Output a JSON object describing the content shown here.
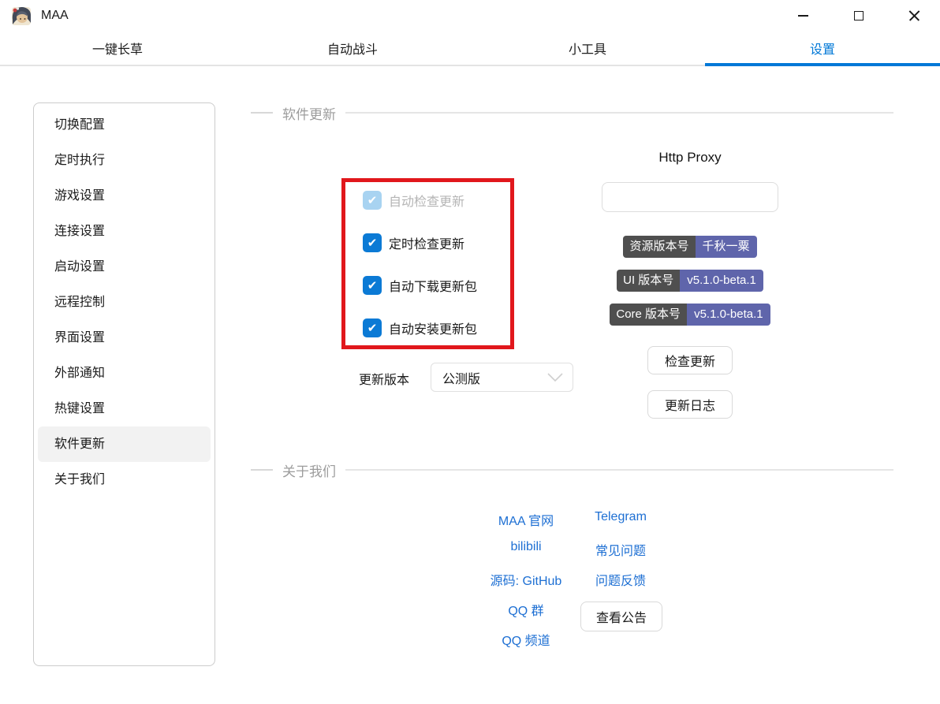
{
  "window": {
    "title": "MAA"
  },
  "tabs": [
    {
      "label": "一键长草",
      "active": false
    },
    {
      "label": "自动战斗",
      "active": false
    },
    {
      "label": "小工具",
      "active": false
    },
    {
      "label": "设置",
      "active": true
    }
  ],
  "sidebar": {
    "items": [
      {
        "label": "切换配置"
      },
      {
        "label": "定时执行"
      },
      {
        "label": "游戏设置"
      },
      {
        "label": "连接设置"
      },
      {
        "label": "启动设置"
      },
      {
        "label": "远程控制"
      },
      {
        "label": "界面设置"
      },
      {
        "label": "外部通知"
      },
      {
        "label": "热键设置"
      },
      {
        "label": "软件更新"
      },
      {
        "label": "关于我们"
      }
    ],
    "active_index": 9
  },
  "update_section": {
    "title": "软件更新",
    "checkboxes": [
      {
        "label": "自动检查更新",
        "checked": true,
        "disabled": true
      },
      {
        "label": "定时检查更新",
        "checked": true,
        "disabled": false
      },
      {
        "label": "自动下载更新包",
        "checked": true,
        "disabled": false
      },
      {
        "label": "自动安装更新包",
        "checked": true,
        "disabled": false
      }
    ],
    "channel": {
      "label": "更新版本",
      "value": "公测版"
    },
    "proxy": {
      "label": "Http Proxy",
      "value": "",
      "placeholder": ""
    },
    "badges": [
      {
        "key": "资源版本号",
        "value": "千秋一粟"
      },
      {
        "key": "UI 版本号",
        "value": "v5.1.0-beta.1"
      },
      {
        "key": "Core 版本号",
        "value": "v5.1.0-beta.1"
      }
    ],
    "check_button": "检查更新",
    "changelog_button": "更新日志"
  },
  "about_section": {
    "title": "关于我们",
    "links_left": [
      {
        "label": "MAA 官网"
      },
      {
        "label": "bilibili"
      },
      {
        "label": "源码: GitHub"
      },
      {
        "label": "QQ 群"
      },
      {
        "label": "QQ 频道"
      }
    ],
    "links_right": [
      {
        "label": "Telegram"
      },
      {
        "label": "常见问题"
      },
      {
        "label": "问题反馈"
      }
    ],
    "announcement_button": "查看公告"
  },
  "colors": {
    "accent": "#0078d7",
    "checkbox_blue": "#0b7ad5",
    "checkbox_disabled": "#a8d3f1",
    "highlight_red": "#e1171c",
    "badge_key_bg": "#4f4f4f",
    "badge_val_bg": "#5f65ab",
    "link_blue": "#1d6fd3"
  }
}
